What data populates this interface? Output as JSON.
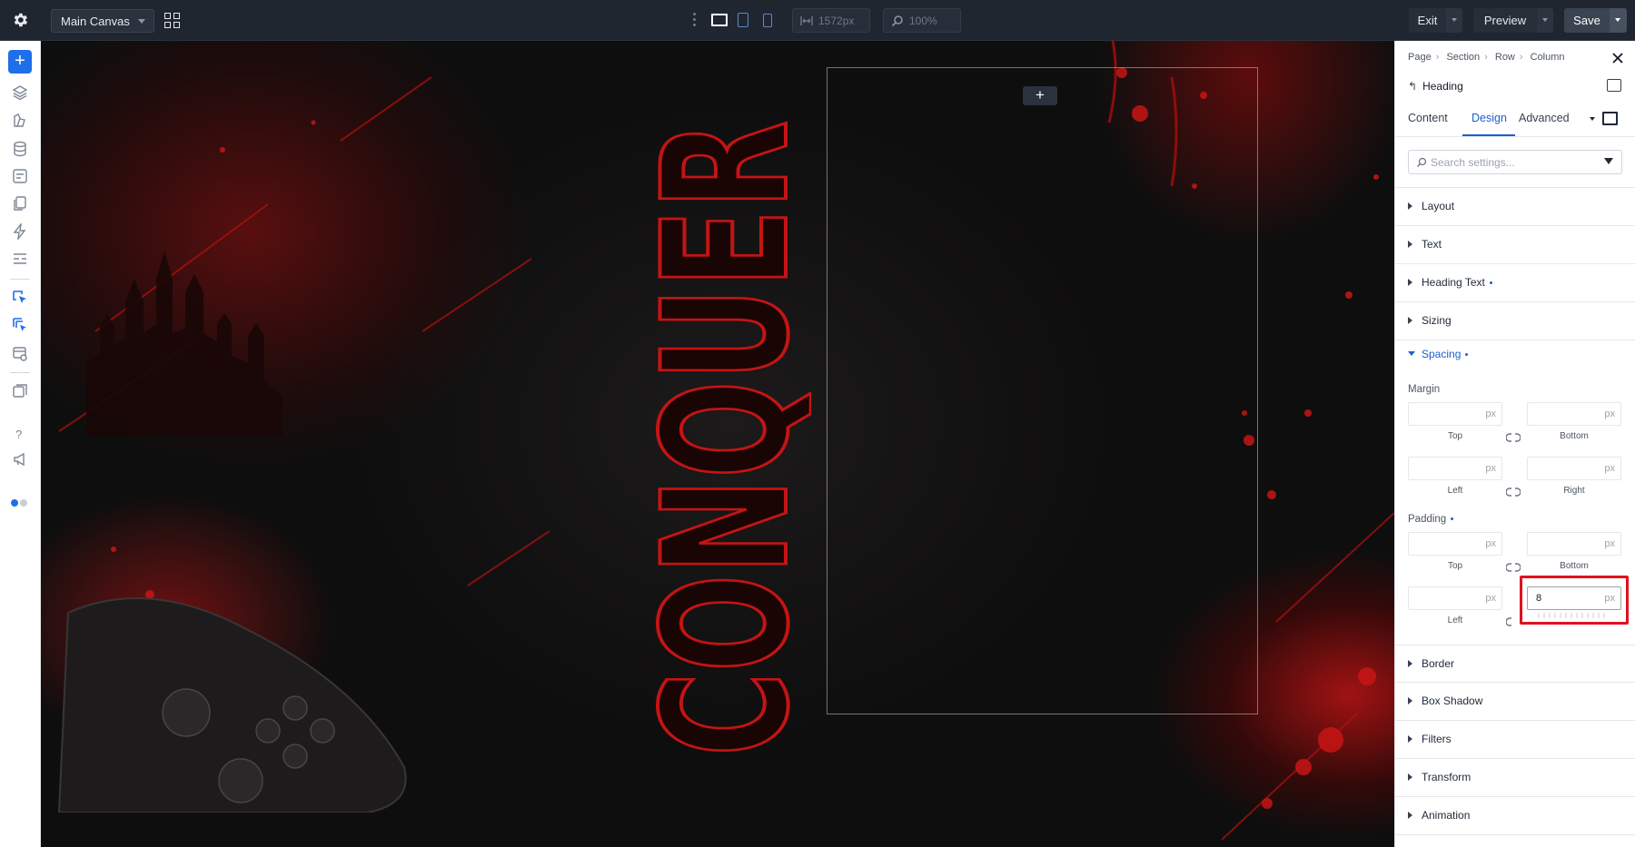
{
  "topbar": {
    "canvas_select": "Main Canvas",
    "width_value": "1572px",
    "zoom_value": "100%",
    "exit_label": "Exit",
    "preview_label": "Preview",
    "save_label": "Save"
  },
  "breadcrumb": [
    "Page",
    "Section",
    "Row",
    "Column"
  ],
  "element": {
    "title": "Heading"
  },
  "tabs": [
    {
      "label": "Content",
      "active": false
    },
    {
      "label": "Design",
      "active": true
    },
    {
      "label": "Advanced",
      "active": false
    }
  ],
  "search": {
    "placeholder": "Search settings..."
  },
  "sections_top": [
    {
      "label": "Layout",
      "modified": false
    },
    {
      "label": "Text",
      "modified": false
    },
    {
      "label": "Heading Text",
      "modified": true
    },
    {
      "label": "Sizing",
      "modified": false
    }
  ],
  "spacing": {
    "label": "Spacing",
    "margin": {
      "label": "Margin",
      "top_label": "Top",
      "bottom_label": "Bottom",
      "left_label": "Left",
      "right_label": "Right",
      "unit": "px"
    },
    "padding": {
      "label": "Padding",
      "top_label": "Top",
      "bottom_label": "Bottom",
      "left_label": "Left",
      "right_value": "8",
      "unit": "px"
    }
  },
  "sections_bottom": [
    {
      "label": "Border"
    },
    {
      "label": "Box Shadow"
    },
    {
      "label": "Filters"
    },
    {
      "label": "Transform"
    },
    {
      "label": "Animation"
    }
  ],
  "canvas": {
    "heading_text": "CONQUER",
    "add_label": "+"
  },
  "colors": {
    "accent": "#1d5fd0",
    "heading_outline": "#c41414",
    "highlight": "#e0111f"
  }
}
